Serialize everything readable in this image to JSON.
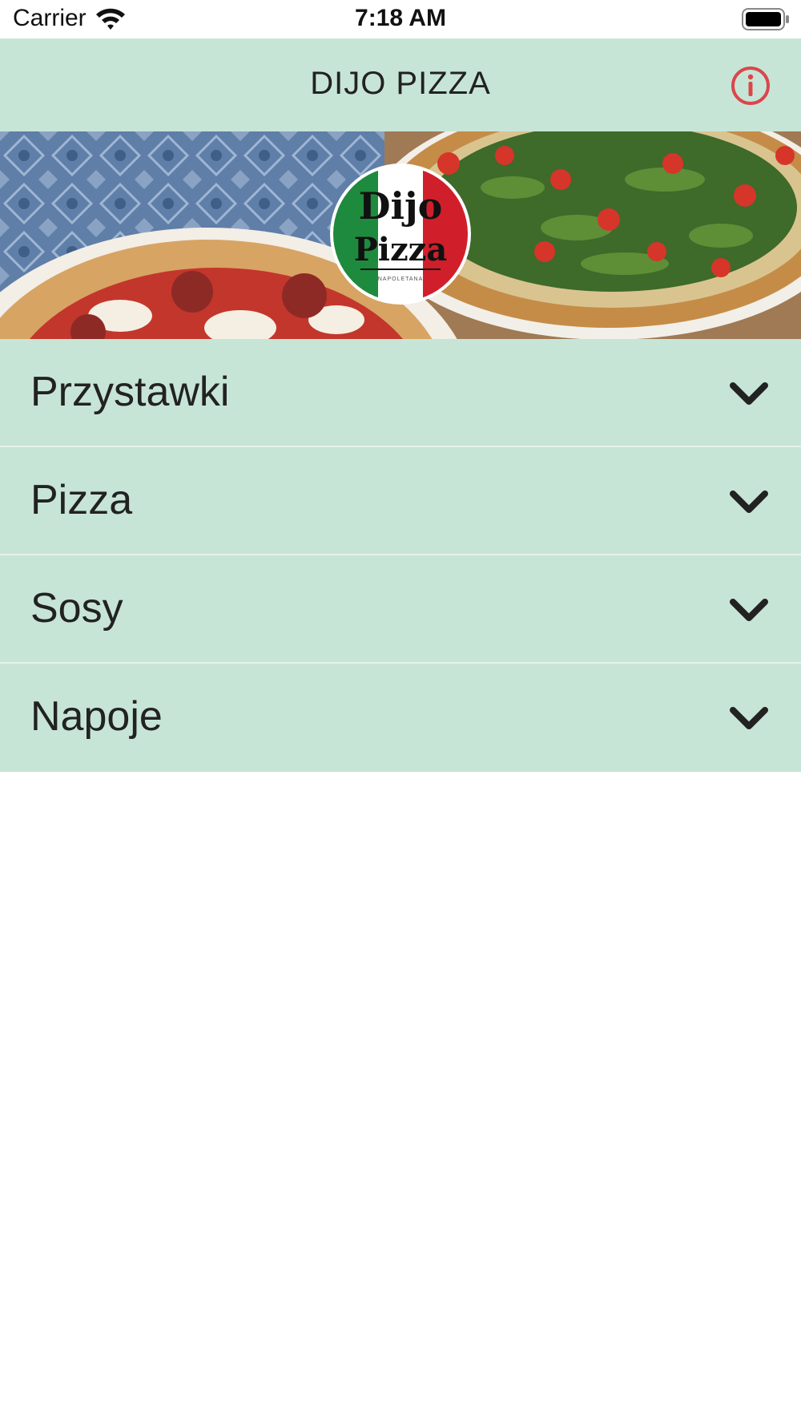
{
  "status_bar": {
    "carrier": "Carrier",
    "time": "7:18 AM"
  },
  "nav": {
    "title": "DIJO PIZZA",
    "info_icon": "info-circle-icon"
  },
  "hero": {
    "logo_line1": "Dijo",
    "logo_line2": "Pizza",
    "logo_sub": "NAPOLETANA"
  },
  "menu": {
    "items": [
      {
        "label": "Przystawki",
        "icon": "chevron-down-icon"
      },
      {
        "label": "Pizza",
        "icon": "chevron-down-icon"
      },
      {
        "label": "Sosy",
        "icon": "chevron-down-icon"
      },
      {
        "label": "Napoje",
        "icon": "chevron-down-icon"
      }
    ]
  },
  "colors": {
    "accent_bg": "#c7e5d7",
    "info_icon": "#d9474b",
    "text": "#222222",
    "separator": "#e7f1ec"
  }
}
